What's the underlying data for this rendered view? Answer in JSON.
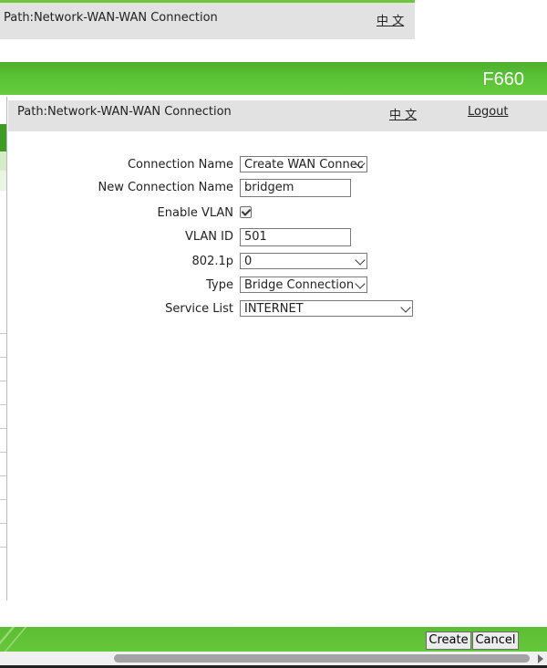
{
  "background_window": {
    "path": "Path:Network-WAN-WAN Connection",
    "lang": "中 文"
  },
  "header": {
    "model": "F660"
  },
  "pathbar": {
    "path": "Path:Network-WAN-WAN Connection",
    "lang": "中 文",
    "logout": "Logout"
  },
  "form": {
    "connection_name": {
      "label": "Connection Name",
      "value": "Create WAN Connec"
    },
    "new_connection_name": {
      "label": "New Connection Name",
      "value": "bridgem"
    },
    "enable_vlan": {
      "label": "Enable VLAN",
      "checked": true
    },
    "vlan_id": {
      "label": "VLAN ID",
      "value": "501"
    },
    "dot1p": {
      "label": "802.1p",
      "value": "0"
    },
    "type": {
      "label": "Type",
      "value": "Bridge Connection"
    },
    "service_list": {
      "label": "Service List",
      "value": "INTERNET"
    }
  },
  "buttons": {
    "create": "Create",
    "cancel": "Cancel"
  },
  "colors": {
    "brand_green": "#58c235",
    "bar_gray": "#e2e2e2"
  }
}
